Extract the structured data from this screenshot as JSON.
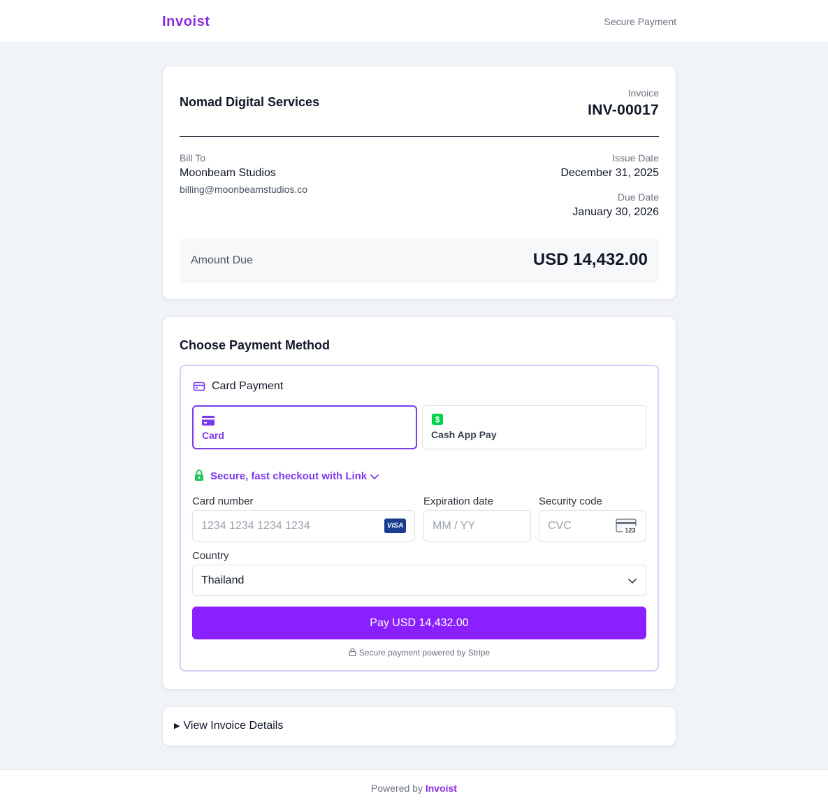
{
  "header": {
    "brand": "Invoist",
    "secure_label": "Secure Payment"
  },
  "invoice": {
    "company": "Nomad Digital Services",
    "invoice_label": "Invoice",
    "invoice_number": "INV-00017",
    "bill_to_label": "Bill To",
    "bill_to_name": "Moonbeam Studios",
    "bill_to_email": "billing@moonbeamstudios.co",
    "issue_date_label": "Issue Date",
    "issue_date": "December 31, 2025",
    "due_date_label": "Due Date",
    "due_date": "January 30, 2026",
    "amount_due_label": "Amount Due",
    "amount_due": "USD 14,432.00"
  },
  "payment": {
    "title": "Choose Payment Method",
    "card_payment_title": "Card Payment",
    "tabs": [
      {
        "label": "Card",
        "icon": "card-icon",
        "selected": true
      },
      {
        "label": "Cash App Pay",
        "icon": "cash-app-icon",
        "selected": false
      }
    ],
    "link_text": "Secure, fast checkout with Link",
    "card_number_label": "Card number",
    "card_number_placeholder": "1234 1234 1234 1234",
    "card_brand": "VISA",
    "expiration_label": "Expiration date",
    "expiration_placeholder": "MM / YY",
    "security_label": "Security code",
    "security_placeholder": "CVC",
    "cvc_icon_text": "123",
    "country_label": "Country",
    "country_value": "Thailand",
    "pay_button": "Pay USD 14,432.00",
    "stripe_note": "Secure payment powered by Stripe"
  },
  "details": {
    "toggle_label": "View Invoice Details"
  },
  "footer": {
    "prefix": "Powered by",
    "brand": "Invoist"
  },
  "colors": {
    "accent": "#8a20ff",
    "brand": "#8a2be2",
    "link_green": "#22c55e",
    "visa_blue": "#1a3d8f"
  }
}
